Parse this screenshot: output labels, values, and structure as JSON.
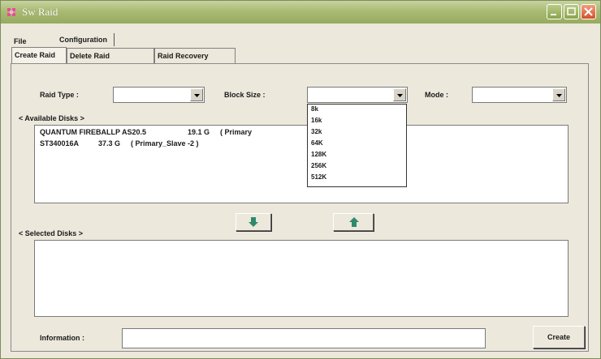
{
  "window": {
    "title": "Sw Raid"
  },
  "menu": {
    "file": "File",
    "configuration": "Configuration"
  },
  "tabs": [
    {
      "label": "Create Raid",
      "active": true
    },
    {
      "label": "Delete Raid",
      "active": false
    },
    {
      "label": "Raid Recovery",
      "active": false
    }
  ],
  "form": {
    "raid_type_label": "Raid Type :",
    "raid_type_value": "",
    "block_size_label": "Block Size :",
    "block_size_value": "",
    "mode_label": "Mode :",
    "mode_value": ""
  },
  "available": {
    "label": "< Available Disks >",
    "disks": [
      {
        "name": "QUANTUM FIREBALLP AS20.5",
        "size": "19.1 G",
        "role": "( Primary"
      },
      {
        "name": "ST340016A",
        "size": "37.3 G",
        "role": "( Primary_Slave -2 )"
      }
    ]
  },
  "block_size_options": [
    "8k",
    "16k",
    "32k",
    "64K",
    "128K",
    "256K",
    "512K"
  ],
  "selected": {
    "label": "< Selected Disks >"
  },
  "info": {
    "label": "Information :",
    "value": ""
  },
  "buttons": {
    "create": "Create",
    "move_down_icon": "arrow-down-icon",
    "move_up_icon": "arrow-up-icon"
  },
  "colors": {
    "titlebar": "#a9bb73",
    "panel": "#ece8dc",
    "arrow": "#2f8a6c",
    "close": "#d4502a"
  }
}
